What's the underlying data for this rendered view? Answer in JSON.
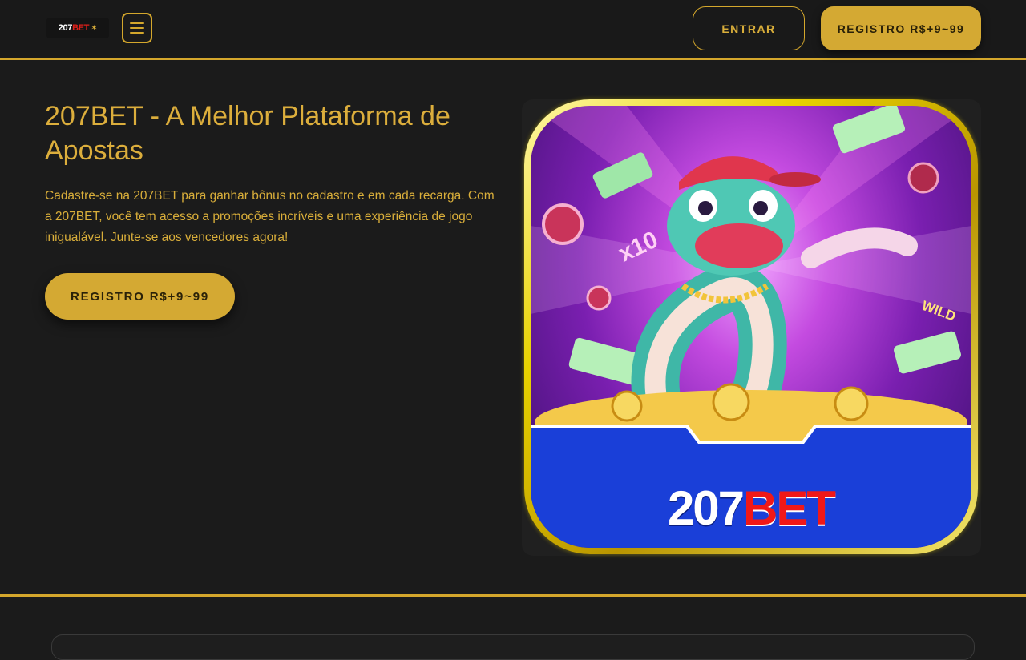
{
  "header": {
    "logo": {
      "text_primary": "207",
      "text_secondary": "BET",
      "icon": "mascot-icon"
    },
    "menu_icon": "hamburger-icon",
    "login_label": "ENTRAR",
    "register_label": "REGISTRO R$+9~99"
  },
  "hero": {
    "title": "207BET - A Melhor Plataforma de Apostas",
    "description": "Cadastre-se na 207BET para ganhar bônus no cadastro e em cada recarga. Com a 207BET, você tem acesso a promoções incríveis e uma experiência de jogo inigualável. Junte-se aos vencedores agora!",
    "cta_label": "REGISTRO R$+9~99"
  },
  "game_image": {
    "brand_primary": "207",
    "brand_secondary": "BET",
    "badges": [
      "x10",
      "WILD"
    ]
  },
  "colors": {
    "accent": "#d4a72c",
    "background": "#1b1b1b",
    "button_text": "#2a2108",
    "brand_red": "#f01818",
    "banner_blue": "#1a3fd8"
  }
}
